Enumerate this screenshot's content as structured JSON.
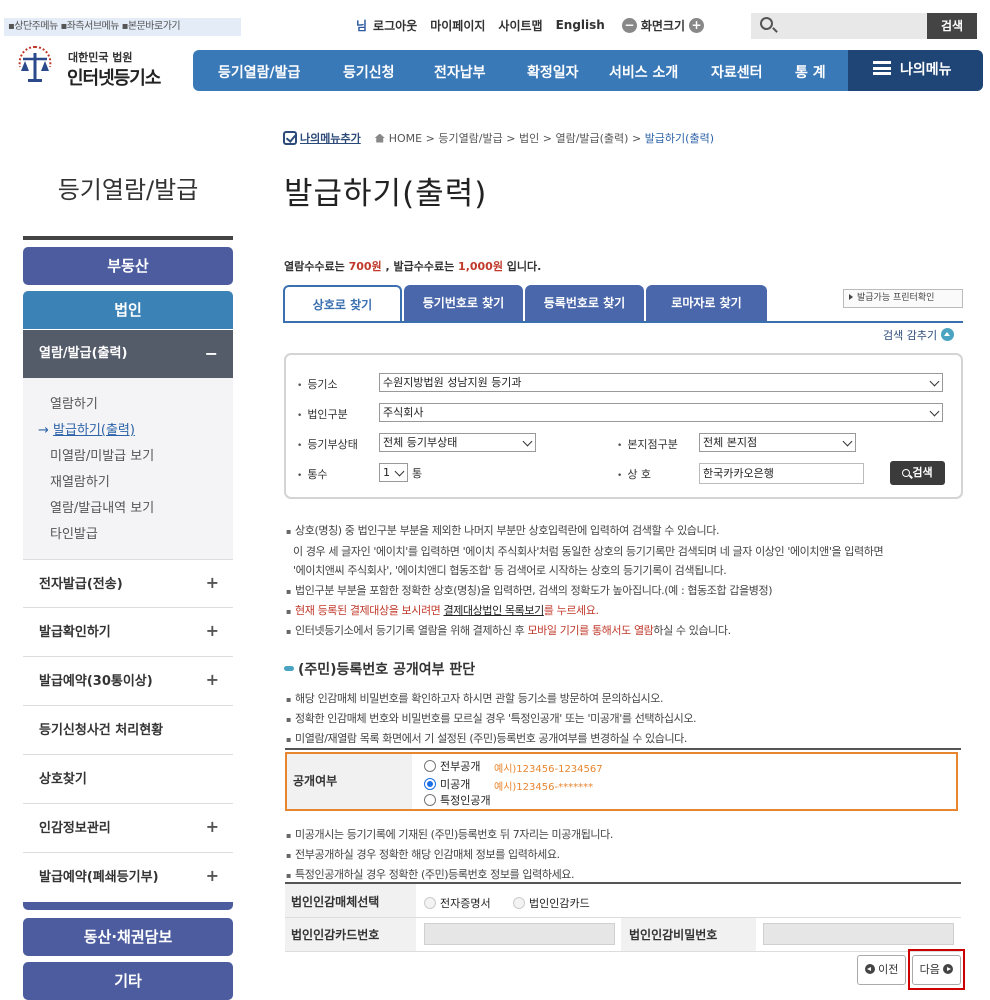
{
  "skip_nav": "▪상단주메뉴 ▪좌측서브메뉴 ▪본문바로가기",
  "util": {
    "nim": "님",
    "logout": "로그아웃",
    "mypage": "마이페이지",
    "sitemap": "사이트맵",
    "english": "English",
    "zoom": "화면크기",
    "minus": "−",
    "plus": "+"
  },
  "search_btn": "검색",
  "logo": {
    "line1": "대한민국 법원",
    "line2": "인터넷등기소"
  },
  "gnb": [
    "등기열람/발급",
    "등기신청",
    "전자납부",
    "확정일자",
    "서비스 소개",
    "자료센터",
    "통 계"
  ],
  "my_menu": "나의메뉴",
  "left": {
    "title": "등기열람/발급",
    "realestate": "부동산",
    "corp": "법인",
    "sub_head": "열람/발급(출력)",
    "sub_items": [
      "열람하기",
      "발급하기(출력)",
      "미열람/미발급 보기",
      "재열람하기",
      "열람/발급내역 보기",
      "타인발급"
    ],
    "current_marker": "→",
    "nav": [
      "전자발급(전송)",
      "발급확인하기",
      "발급예약(30통이상)",
      "등기신청사건 처리현황",
      "상호찾기",
      "인감정보관리",
      "발급예약(폐쇄등기부)"
    ],
    "movable": "동산·채권담보",
    "etc": "기타"
  },
  "crumb": {
    "my_add": "나의메뉴추가",
    "home": "HOME",
    "c1": "등기열람/발급",
    "c2": "법인",
    "c3": "열람/발급(출력)",
    "current": "발급하기(출력)"
  },
  "page_title": "발급하기(출력)",
  "fee": {
    "pre": "열람수수료는 ",
    "view_fee": "700원",
    "mid": " , 발급수수료는 ",
    "issue_fee": "1,000원",
    "post": " 입니다."
  },
  "tabs": [
    "상호로 찾기",
    "등기번호로 찾기",
    "등록번호로 찾기",
    "로마자로 찾기"
  ],
  "printer_check": "발급가능 프린터확인",
  "hide_search": "검색 감추기",
  "form": {
    "registry_label": "등기소",
    "registry_value": "수원지방법원 성남지원 등기과",
    "corp_type_label": "법인구분",
    "corp_type_value": "주식회사",
    "status_label": "등기부상태",
    "status_value": "전체 등기부상태",
    "branch_label": "본지점구분",
    "branch_value": "전체 본지점",
    "count_label": "통수",
    "count_value": "1",
    "count_unit": "통",
    "name_label": "상 호",
    "name_value": "한국카카오은행",
    "search": "검색"
  },
  "notes": {
    "n1": "상호(명칭) 중 법인구분 부분을 제외한 나머지 부분만 상호입력란에 입력하여 검색할 수 있습니다.",
    "n1a": "이 경우 세 글자인 '에이치'를 입력하면 '에이치 주식회사'처럼 동일한 상호의 등기기록만 검색되며 네 글자 이상인 '에이치앤'을 입력하면",
    "n1b": "'에이치앤씨 주식회사', '에이치앤디 협동조합' 등 검색어로 시작하는 상호의 등기기록이 검색됩니다.",
    "n2": "법인구분 부분을 포함한 정확한 상호(명칭)을 입력하면, 검색의 정확도가 높아집니다.(예 : 협동조합 갑을병정)",
    "n3a": "현재 등록된 결제대상을 보시려면 ",
    "n3link": "결제대상법인 목록보기",
    "n3b": "를 누르세요.",
    "n4a": "인터넷등기소에서 등기기록 열람을 위해 결제하신 후 ",
    "n4red": "모바일 기기를 통해서도 열람",
    "n4b": "하실 수 있습니다."
  },
  "disclosure": {
    "title": "(주민)등록번호 공개여부 판단",
    "d1": "해당 인감매체 비밀번호를 확인하고자 하시면 관할 등기소를 방문하여 문의하십시오.",
    "d2": "정확한 인감매체 번호와 비밀번호를 모르실 경우 '특정인공개' 또는 '미공개'를 선택하십시오.",
    "d3": "미열람/재열람 목록 화면에서 기 설정된 (주민)등록번호 공개여부를 변경하실 수 있습니다.",
    "label": "공개여부",
    "opt_all": "전부공개",
    "ex_all": "예시)123456-1234567",
    "opt_none": "미공개",
    "ex_none": "예시)123456-*******",
    "opt_specific": "특정인공개",
    "after1": "미공개시는 등기기록에 기재된 (주민)등록번호 뒤 7자리는 미공개됩니다.",
    "after2": "전부공개하실 경우 정확한 해당 인감매체 정보를 입력하세요.",
    "after3": "특정인공개하실 경우 정확한 (주민)등록번호 정보를 입력하세요."
  },
  "seal": {
    "media_label": "법인인감매체선택",
    "opt_cert": "전자증명서",
    "opt_card": "법인인감카드",
    "card_no_label": "법인인감카드번호",
    "pw_label": "법인인감비밀번호"
  },
  "buttons": {
    "prev": "이전",
    "next": "다음"
  },
  "colors": {
    "gnb": "#3a79b8",
    "my_menu": "#1e4576",
    "pill": "#4c5c9f",
    "corp_pill": "#3b83b7",
    "highlight": "#e8862f",
    "red_box": "#cc0000"
  }
}
